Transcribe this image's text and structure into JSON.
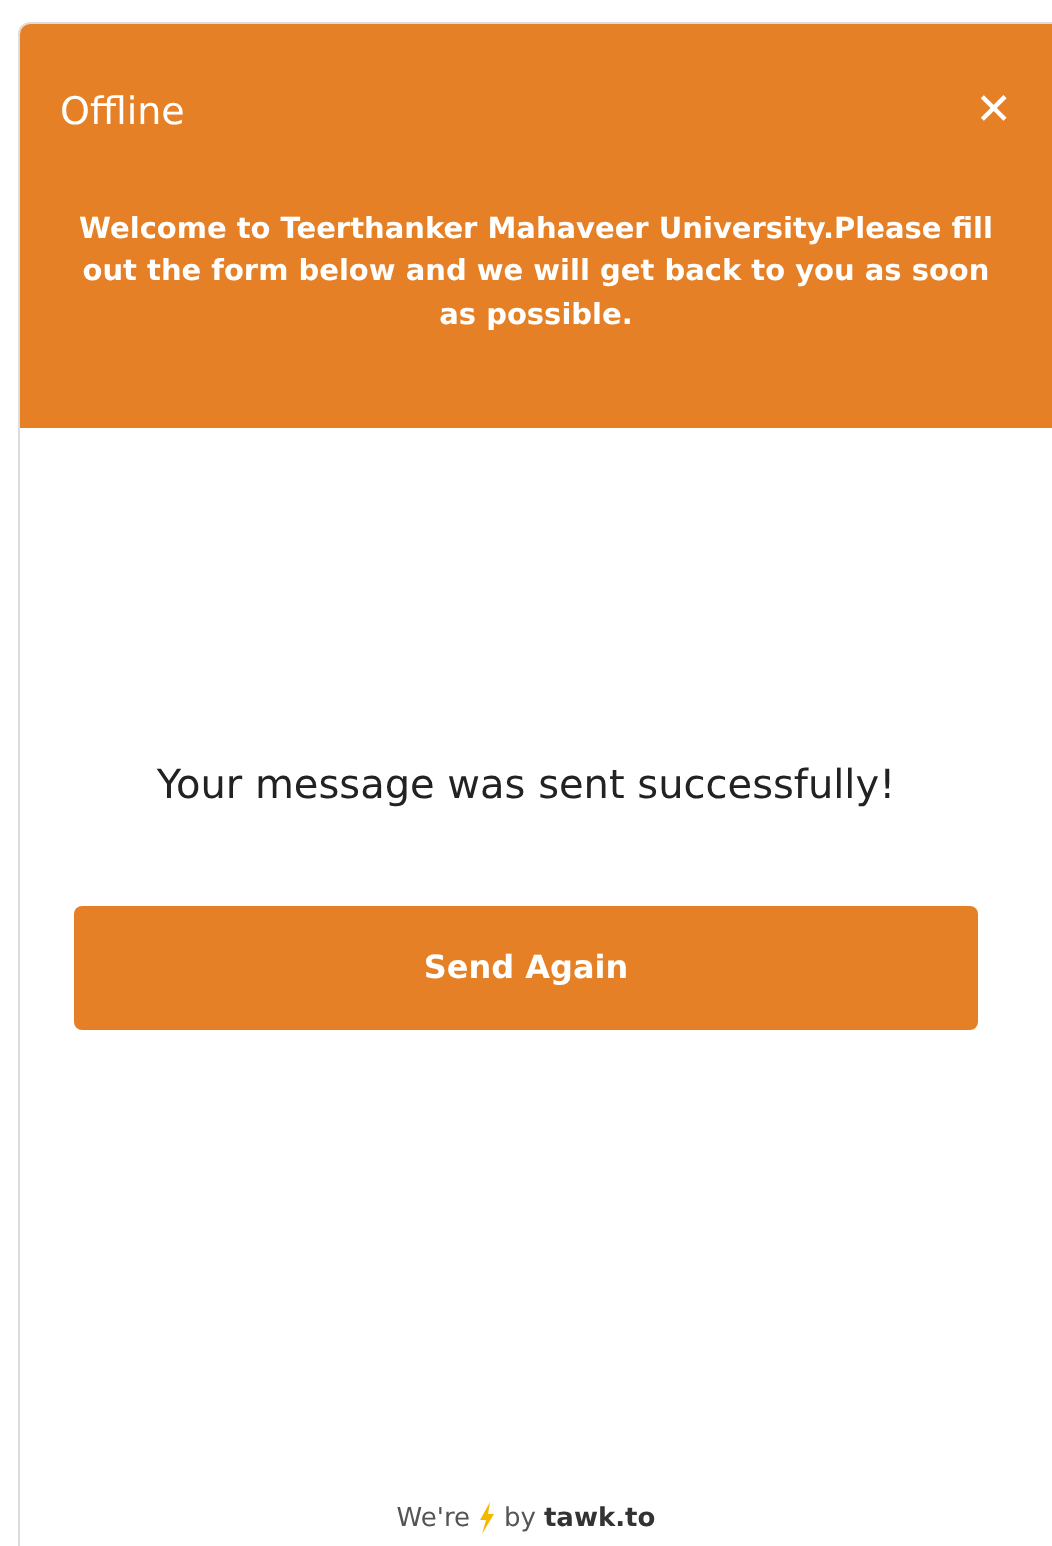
{
  "header": {
    "title": "Offline",
    "close": "✕",
    "welcome": "Welcome to Teerthanker Mahaveer University.Please fill out the form below and we will get back to you as soon as possible."
  },
  "body": {
    "message": "Your message was sent successfully!",
    "button": "Send Again"
  },
  "footer": {
    "prefix": "We're",
    "by": "by",
    "brand": "tawk.to"
  }
}
